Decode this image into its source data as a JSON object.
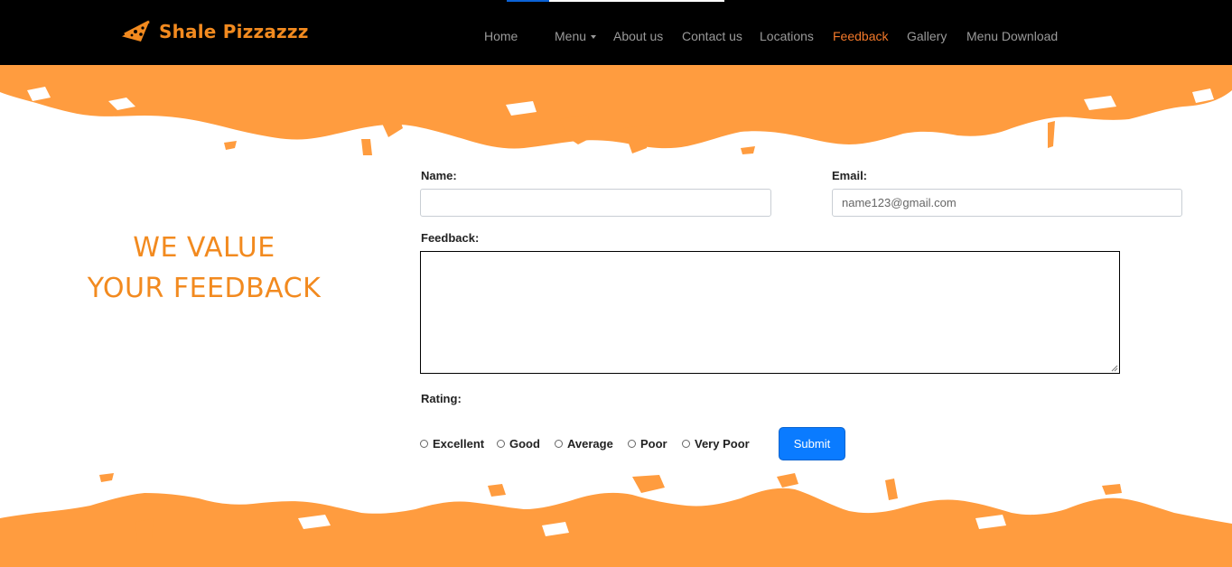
{
  "brand": {
    "name": "Shale Pizzazzz",
    "icon": "pizza-slice-icon",
    "color": "#f28a1f"
  },
  "nav": {
    "items": [
      {
        "label": "Home"
      },
      {
        "label": "Menu",
        "icon": "caret-down-icon"
      },
      {
        "label": "About us"
      },
      {
        "label": "Contact us"
      },
      {
        "label": "Locations"
      },
      {
        "label": "Feedback",
        "active": true
      },
      {
        "label": "Gallery"
      },
      {
        "label": "Menu Download"
      }
    ],
    "active_color": "#f2782a"
  },
  "headline": {
    "line1": "WE VALUE",
    "line2": "YOUR FEEDBACK"
  },
  "form": {
    "name_label": "Name:",
    "name_value": "",
    "email_label": "Email:",
    "email_placeholder": "name123@gmail.com",
    "feedback_label": "Feedback:",
    "rating_label": "Rating:",
    "rating_options": [
      "Excellent",
      "Good",
      "Average",
      "Poor",
      "Very Poor"
    ],
    "submit_label": "Submit"
  },
  "colors": {
    "accent_orange": "#ff9c3f",
    "submit_blue": "#0a7bff",
    "navbar_bg": "#000000"
  }
}
